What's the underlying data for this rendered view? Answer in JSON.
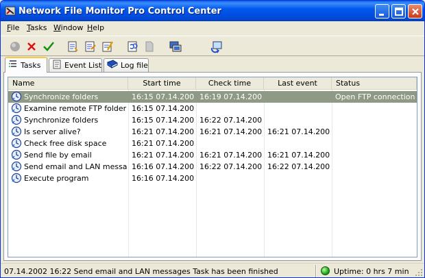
{
  "window": {
    "title": "Network File Monitor Pro Control Center",
    "accent": "#0058ee"
  },
  "menu": [
    "File",
    "Tasks",
    "Window",
    "Help"
  ],
  "toolbar": {
    "buttons": [
      "stop-circle-icon",
      "delete-x-icon",
      "check-icon",
      "new-task-icon",
      "edit-task-icon",
      "task-properties-icon",
      "refresh-icon",
      "blank-page-icon",
      "monitor-icon",
      "network-refresh-icon"
    ]
  },
  "tabs": [
    {
      "label": "Tasks",
      "icon": "tasks-icon",
      "active": true
    },
    {
      "label": "Event List",
      "icon": "event-list-icon",
      "active": false
    },
    {
      "label": "Log file",
      "icon": "log-book-icon",
      "active": false
    }
  ],
  "list": {
    "columns": {
      "name": "Name",
      "start": "Start time",
      "check": "Check time",
      "last": "Last event",
      "status": "Status"
    },
    "rows": [
      {
        "name": "Synchronize folders",
        "start": "16:15  07.14.2002",
        "check": "16:19  07.14.2002",
        "last": "",
        "status": "Open FTP connection",
        "selected": true
      },
      {
        "name": "Examine remote FTP folder",
        "start": "16:15  07.14.2002",
        "check": "",
        "last": "",
        "status": "",
        "selected": false
      },
      {
        "name": "Synchronize folders",
        "start": "16:15  07.14.2002",
        "check": "16:22  07.14.2002",
        "last": "",
        "status": "",
        "selected": false
      },
      {
        "name": "Is server alive?",
        "start": "16:21  07.14.2002",
        "check": "16:21  07.14.2002",
        "last": "16:21  07.14.2002",
        "status": "",
        "selected": false
      },
      {
        "name": "Check free disk space",
        "start": "16:21  07.14.2002",
        "check": "",
        "last": "",
        "status": "",
        "selected": false
      },
      {
        "name": "Send file by email",
        "start": "16:21  07.14.2002",
        "check": "16:21  07.14.2002",
        "last": "16:21  07.14.2002",
        "status": "",
        "selected": false
      },
      {
        "name": "Send email and LAN messages",
        "start": "16:16  07.14.2002",
        "check": "16:22  07.14.2002",
        "last": "16:22  07.14.2002",
        "status": "",
        "selected": false
      },
      {
        "name": "Execute program",
        "start": "16:16  07.14.2002",
        "check": "",
        "last": "",
        "status": "",
        "selected": false
      }
    ]
  },
  "statusbar": {
    "message": "07.14.2002  16:22  Send email and LAN messages Task has been finished",
    "uptime": "Uptime: 0 hrs 7 min",
    "uptime_color": "#1fa31f"
  }
}
